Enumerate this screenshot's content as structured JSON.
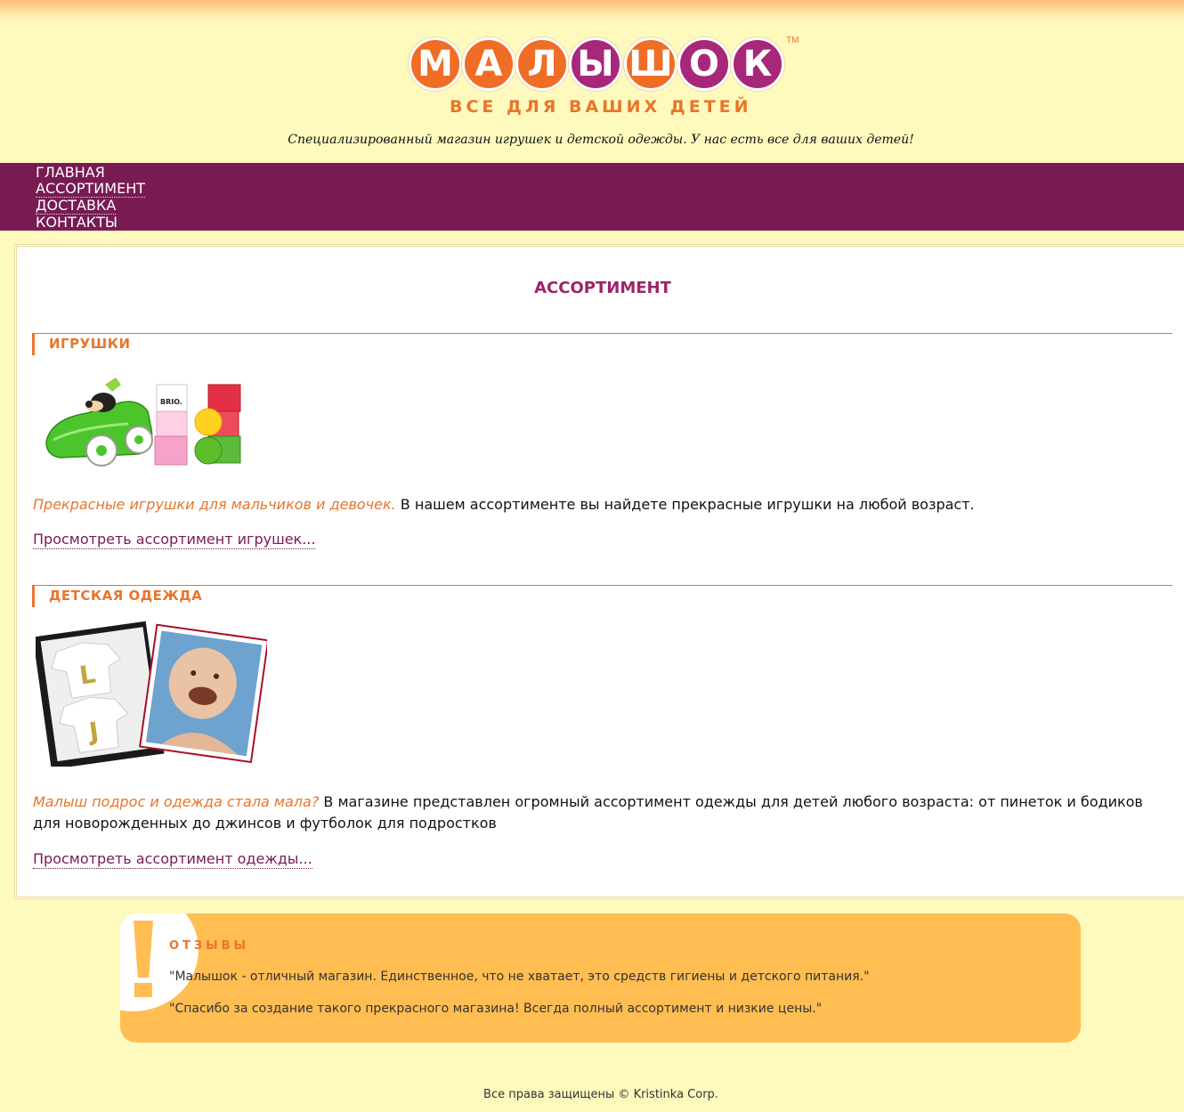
{
  "header": {
    "logo_letters": [
      "М",
      "А",
      "Л",
      "Ы",
      "Ш",
      "О",
      "К"
    ],
    "logo_tm": "TM",
    "logo_subtitle": "ВСЕ ДЛЯ ВАШИХ ДЕТЕЙ",
    "tagline": "Специализированный магазин игрушек и детской одежды. У нас есть все для ваших детей!"
  },
  "colors": {
    "orange": "#e8752c",
    "purple": "#9c246a",
    "nav_bg": "#781b53",
    "page_bg": "#fef9bd",
    "reviews_bg": "#ffbd52"
  },
  "nav": {
    "items": [
      {
        "label": "ГЛАВНАЯ"
      },
      {
        "label": "АССОРТИМЕНТ"
      },
      {
        "label": "ДОСТАВКА"
      },
      {
        "label": "КОНТАКТЫ"
      }
    ]
  },
  "main": {
    "title": "АССОРТИМЕНТ",
    "sections": [
      {
        "heading": "ИГРУШКИ",
        "lead": "Прекрасные игрушки для мальчиков и девочек.",
        "text": " В нашем ассортименте вы найдете прекрасные игрушки на любой возраст.",
        "link": "Просмотреть ассортимент игрушек...",
        "image_label": "BRIO."
      },
      {
        "heading": "ДЕТСКАЯ ОДЕЖДА",
        "lead": "Малыш подрос и одежда стала мала?",
        "text": " В магазине представлен огромный ассортимент одежды для детей любого возраста: от пинеток и бодиков для новорожденных до джинсов и футболок для подростков",
        "link": "Просмотреть ассортимент одежды..."
      }
    ]
  },
  "reviews": {
    "title": "ОТЗЫВЫ",
    "items": [
      "\"Малышок - отличный магазин. Единственное, что не хватает, это средств гигиены и детского питания.\"",
      "\"Спасибо за создание такого прекрасного магазина! Всегда полный ассортимент и низкие цены.\""
    ]
  },
  "footer": {
    "text": "Все права защищены © Kristinka Corp."
  }
}
